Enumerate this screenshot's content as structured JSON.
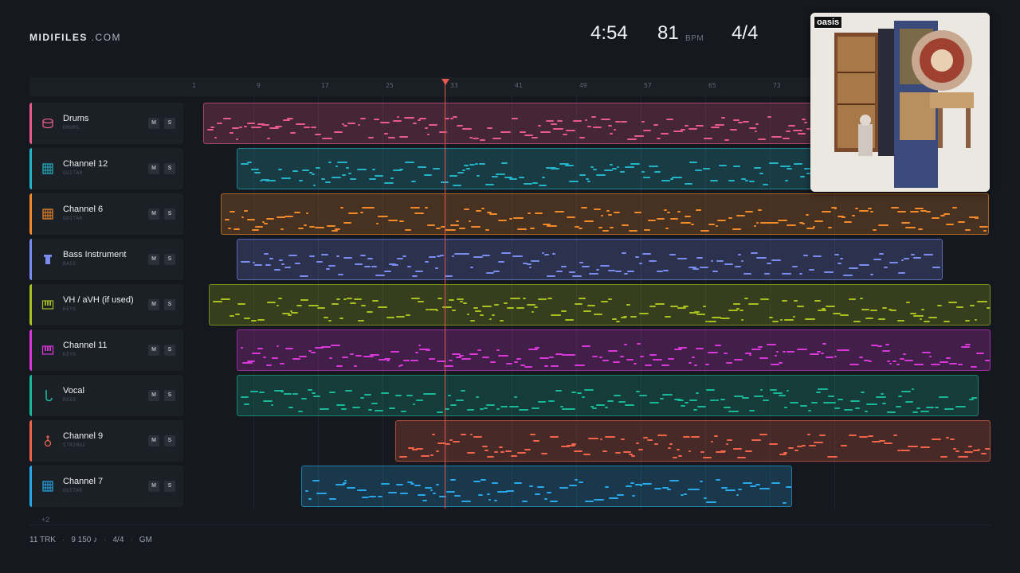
{
  "brand": {
    "name": "MIDIFILES",
    "suffix": ".COM"
  },
  "stats": {
    "duration": "4:54",
    "tempo": "81",
    "tempo_unit": "BPM",
    "time_signature": "4/4"
  },
  "ruler": {
    "ticks": [
      "1",
      "9",
      "17",
      "25",
      "33",
      "41",
      "49",
      "57",
      "65",
      "73"
    ]
  },
  "album": {
    "logo_text": "oasis"
  },
  "tracks": [
    {
      "name": "Drums",
      "type": "DRUMS",
      "icon": "drum-icon",
      "color": "#e85a8a",
      "mute_label": "M",
      "solo_label": "S",
      "start": 0.008,
      "end": 0.85
    },
    {
      "name": "Channel 12",
      "type": "GUITAR",
      "icon": "guitar-grid-icon",
      "color": "#24b4c8",
      "mute_label": "M",
      "solo_label": "S",
      "start": 0.05,
      "end": 0.85
    },
    {
      "name": "Channel 6",
      "type": "GUITAR",
      "icon": "guitar-grid-icon",
      "color": "#f08a2a",
      "mute_label": "M",
      "solo_label": "S",
      "start": 0.03,
      "end": 0.998
    },
    {
      "name": "Bass Instrument",
      "type": "BASS",
      "icon": "bass-icon",
      "color": "#7b8cf0",
      "mute_label": "M",
      "solo_label": "S",
      "start": 0.05,
      "end": 0.94
    },
    {
      "name": "VH / aVH (if used)",
      "type": "KEYS",
      "icon": "keys-icon",
      "color": "#a8c020",
      "mute_label": "M",
      "solo_label": "S",
      "start": 0.015,
      "end": 1.0
    },
    {
      "name": "Channel 11",
      "type": "KEYS",
      "icon": "keys-icon",
      "color": "#d838d8",
      "mute_label": "M",
      "solo_label": "S",
      "start": 0.05,
      "end": 1.0
    },
    {
      "name": "Vocal",
      "type": "REED",
      "icon": "reed-icon",
      "color": "#1ab89a",
      "mute_label": "M",
      "solo_label": "S",
      "start": 0.05,
      "end": 0.985
    },
    {
      "name": "Channel 9",
      "type": "STRINGS",
      "icon": "violin-icon",
      "color": "#f0644a",
      "mute_label": "M",
      "solo_label": "S",
      "start": 0.25,
      "end": 1.0
    },
    {
      "name": "Channel 7",
      "type": "GUITAR",
      "icon": "guitar-grid-icon",
      "color": "#28a8e8",
      "mute_label": "M",
      "solo_label": "S",
      "start": 0.132,
      "end": 0.75
    }
  ],
  "more_tracks": "+2",
  "footer": {
    "tracks": "11 TRK",
    "notes": "9 150 ♪",
    "time_signature": "4/4",
    "standard": "GM"
  }
}
